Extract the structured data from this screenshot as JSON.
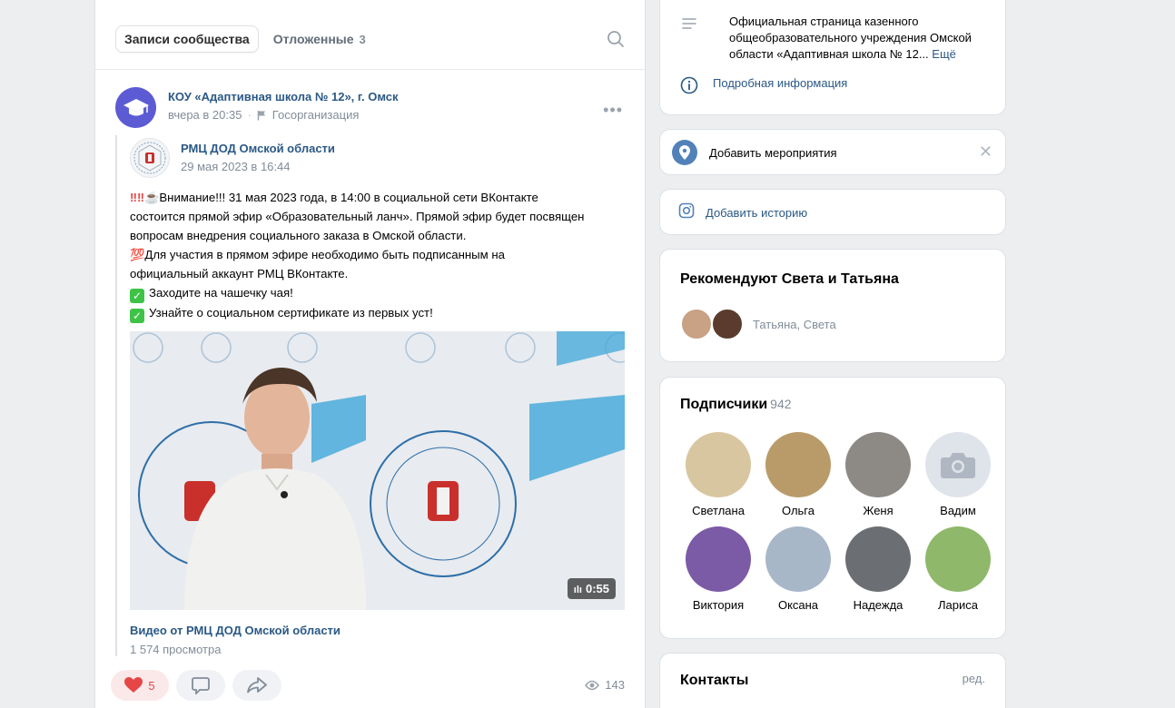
{
  "feed": {
    "tabs": {
      "active": "Записи сообщества",
      "postponed": "Отложенные",
      "postponed_count": "3"
    },
    "post": {
      "author": "КОУ «Адаптивная школа № 12», г. Омск",
      "time": "вчера в 20:35",
      "category": "Госорганизация",
      "repost": {
        "author": "РМЦ ДОД Омской области",
        "date": "29 мая 2023 в 16:44",
        "text_line1": "Внимание!!! 31 мая 2023 года, в 14:00 в социальной сети ВКонтакте",
        "text_line2": "состоится прямой эфир «Образовательный ланч». Прямой эфир будет посвящен",
        "text_line3": "вопросам внедрения социального заказа в Омской области.",
        "text_line4": "Для участия в прямом эфире необходимо быть подписанным на",
        "text_line5": "официальный аккаунт РМЦ ВКонтакте.",
        "text_line6": "Заходите на чашечку чая!",
        "text_line7": "Узнайте о социальном сертификате из первых уст!",
        "emoji_100": "💯",
        "video": {
          "duration": "0:55",
          "title": "Видео от РМЦ ДОД Омской области",
          "views": "1 574 просмотра"
        }
      },
      "likes": "5",
      "views": "143"
    }
  },
  "sidebar": {
    "description": "Официальная страница казенного общеобразовательного учреждения Омской области «Адаптивная школа № 12...",
    "description_more": "Ещё",
    "details_link": "Подробная информация",
    "add_event": "Добавить мероприятия",
    "add_story": "Добавить историю",
    "recommend": {
      "title": "Рекомендуют Света и Татьяна",
      "names": "Татьяна, Света"
    },
    "subscribers": {
      "title": "Подписчики",
      "count": "942",
      "people": [
        {
          "name": "Светлана",
          "color": "#d8c6a0"
        },
        {
          "name": "Ольга",
          "color": "#b99b6a"
        },
        {
          "name": "Женя",
          "color": "#8d8a86"
        },
        {
          "name": "Вадим",
          "color": "#dfe3ea"
        },
        {
          "name": "Виктория",
          "color": "#7b5aa6"
        },
        {
          "name": "Оксана",
          "color": "#a8b7c8"
        },
        {
          "name": "Надежда",
          "color": "#6b6e72"
        },
        {
          "name": "Лариса",
          "color": "#8fb86a"
        }
      ]
    },
    "contacts": {
      "title": "Контакты",
      "edit": "ред."
    }
  }
}
